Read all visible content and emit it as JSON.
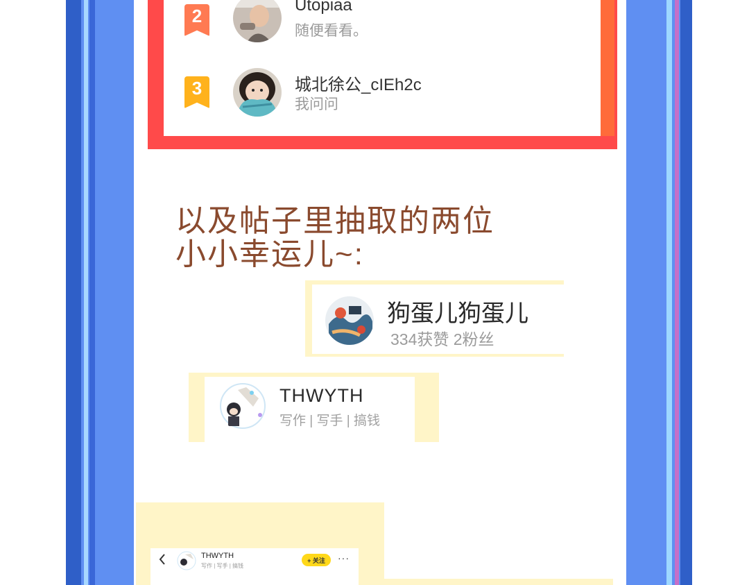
{
  "ranking": [
    {
      "rank": "2",
      "name": "Utopiaa",
      "subtitle": "随便看看。"
    },
    {
      "rank": "3",
      "name": "城北徐公_cIEh2c",
      "subtitle": "我问问"
    }
  ],
  "heading": {
    "line1": "以及帖子里抽取的两位",
    "line2": "小小幸运儿~:"
  },
  "winners": [
    {
      "name": "狗蛋儿狗蛋儿",
      "stats": "334获赞 2粉丝"
    },
    {
      "name": "THWYTH",
      "bio": "写作 | 写手 | 搞钱"
    }
  ],
  "profile_header": {
    "name": "THWYTH",
    "bio": "写作 | 写手 | 搞钱",
    "follow_label": "+ 关注",
    "more": "···"
  },
  "colors": {
    "frame_red": "#ff4a4a",
    "heading_brown": "#8a4a2e",
    "card_cream": "#fff5c8",
    "side_blue": "#5f8ff2",
    "follow_yellow": "#ffd81a"
  }
}
